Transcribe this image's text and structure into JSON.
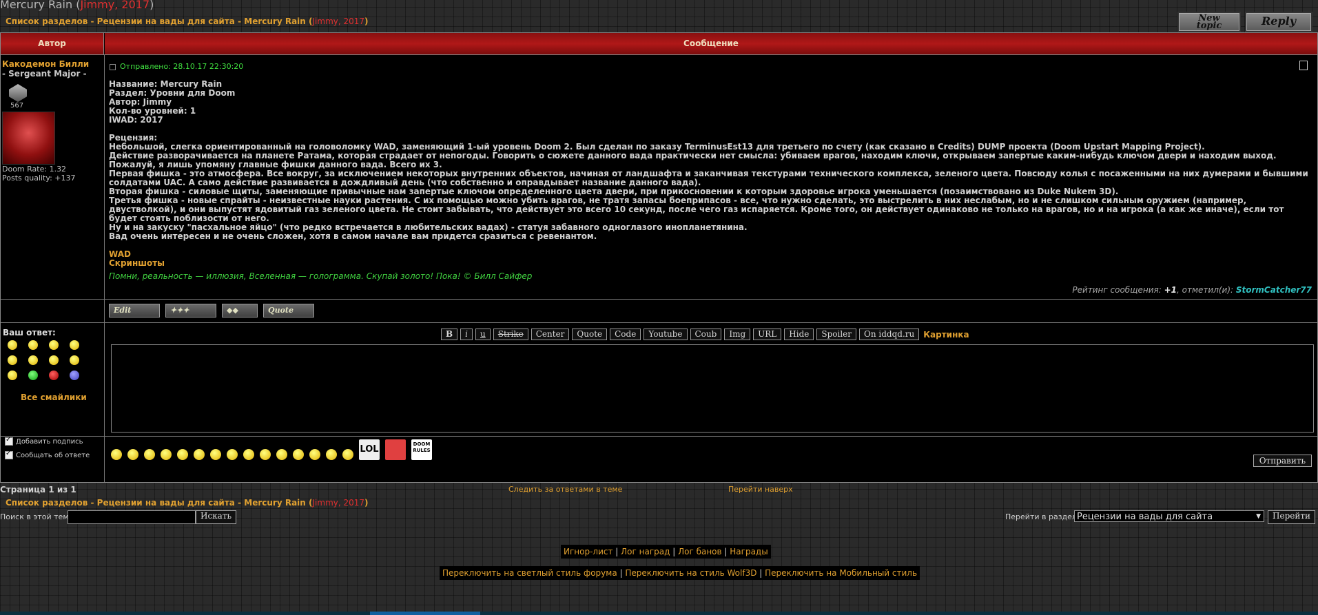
{
  "topic": {
    "title": "Mercury Rain",
    "open_paren": " (",
    "author": "Jimmy, 2017",
    "close_paren": ")"
  },
  "nav": {
    "sections_label": "Список разделов",
    "sep": " - ",
    "section": "Рецензии на вады для сайта",
    "topic": "Mercury Rain",
    "author_date": "Jimmy, 2017"
  },
  "top_buttons": {
    "new_topic": "New topic",
    "reply": "Reply"
  },
  "table": {
    "author_col": "Автор",
    "message_col": "Сообщение"
  },
  "author": {
    "name": "Какодемон Билли",
    "rank": "- Sergeant Major -",
    "post_count": "567",
    "doom_rate": "Doom Rate: 1.32",
    "posts_quality": "Posts quality: +137"
  },
  "post": {
    "sent": "Отправлено: 28.10.17 22:30:20",
    "lines1": [
      "Название: Mercury Rain",
      "Раздел: Уровни для Doom",
      "Автор: Jimmy",
      "Кол-во уровней: 1",
      "IWAD: 2017"
    ],
    "review_header": "Рецензия:",
    "review": [
      "Небольшой, слегка ориентированный на головоломку WAD, заменяющий 1-ый уровень Doom 2. Был сделан по заказу TerminusEst13 для третьего по счету (как сказано в Credits) DUMP проекта (Doom Upstart Mapping Project).",
      "Действие разворачивается на планете Ратама, которая страдает от непогоды. Говорить о сюжете данного вада практически нет смысла: убиваем врагов, находим ключи, открываем запертые каким-нибудь ключом двери и находим выход. Пожалуй, я лишь упомяну главные фишки данного вада. Всего их 3.",
      "Первая фишка - это атмосфера. Все вокруг, за исключением некоторых внутренних объектов, начиная от ландшафта и заканчивая текстурами технического комплекса, зеленого цвета. Повсюду колья с посаженными на них думерами и бывшими солдатами UAC. А само действие развивается в дождливый день (что собственно и оправдывает название данного вада).",
      "Вторая фишка - силовые щиты, заменяющие привычные нам запертые ключом определенного цвета двери, при прикосновении к которым здоровье игрока уменьшается (позаимствовано из Duke Nukem 3D).",
      "Третья фишка - новые спрайты - неизвестные науки растения. С их помощью можно убить врагов, не тратя запасы боеприпасов - все, что нужно сделать, это выстрелить в них неслабым, но и не слишком сильным оружием (например, двустволкой), и они выпустят ядовитый газ зеленого цвета. Не стоит забывать, что действует это всего 10 секунд, после чего газ испаряется. Кроме того, он действует одинаково не только на врагов, но и на игрока (а как же иначе), если тот будет стоять поблизости от него.",
      "Ну и на закуску \"пасхальное яйцо\" (что редко встречается в любительских вадах) - статуя забавного одноглазого инопланетянина.",
      "Вад очень интересен и не очень сложен, хотя в самом начале вам придется сразиться с ревенантом."
    ],
    "link_wad": "WAD",
    "link_screens": "Скриншоты",
    "signature": "Помни, реальность — иллюзия, Вселенная — голограмма. Скупай золото! Пока! © Билл Сайфер",
    "rating_prefix": "Рейтинг сообщения: ",
    "rating_value": "+1",
    "rating_mid": ", отметил(и): ",
    "rating_user": "StormCatcher77"
  },
  "post_buttons": {
    "edit": "Edit",
    "b2": "✦✦✦",
    "b3": "◆◆",
    "quote": "Quote"
  },
  "reply": {
    "label": "Ваш ответ:",
    "all_smileys": "Все смайлики",
    "toolbar": [
      "B",
      "i",
      "u",
      "Strike",
      "Center",
      "Quote",
      "Code",
      "Youtube",
      "Coub",
      "Img",
      "URL",
      "Hide",
      "Spoiler",
      "On iddqd.ru"
    ],
    "picture": "Картинка",
    "add_signature": "Добавить подпись",
    "notify": "Сообщать об ответе",
    "send": "Отправить",
    "lol": "LOL",
    "doom_rules": "DOOM RULES"
  },
  "footer": {
    "pager": "Страница 1 из 1",
    "follow": "Следить за ответами в теме",
    "to_top": "Перейти наверх",
    "search_label": "Поиск в этой теме:",
    "search_btn": "Искать",
    "jump_label": "Перейти в раздел:",
    "jump_value": "Рецензии на вады для сайта",
    "jump_btn": "Перейти",
    "links1": [
      "Игнор-лист",
      "Лог наград",
      "Лог банов",
      "Награды"
    ],
    "links2": [
      "Переключить на светлый стиль форума",
      "Переключить на стиль Wolf3D",
      "Переключить на Мобильный стиль"
    ]
  }
}
